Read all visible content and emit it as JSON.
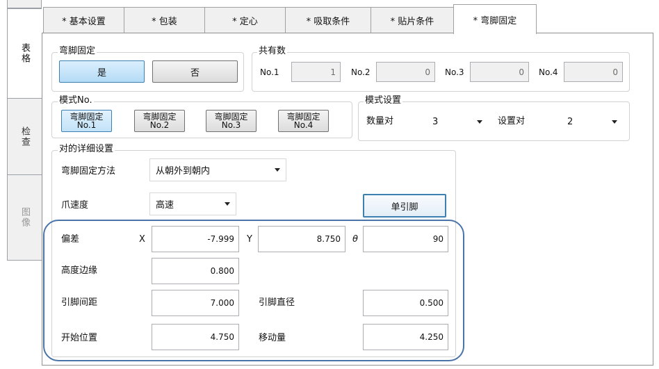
{
  "side_tabs": [
    "表格",
    "检查",
    "图像"
  ],
  "tabs": [
    "* 基本设置",
    "* 包装",
    "* 定心",
    "* 吸取条件",
    "* 贴片条件",
    "* 弯脚固定"
  ],
  "lead_clinch": {
    "group_label": "弯脚固定",
    "yes_label": "是",
    "no_label": "否"
  },
  "shared": {
    "group_label": "共有数",
    "items": [
      {
        "label": "No.1",
        "value": "1"
      },
      {
        "label": "No.2",
        "value": "0"
      },
      {
        "label": "No.3",
        "value": "0"
      },
      {
        "label": "No.4",
        "value": "0"
      }
    ]
  },
  "pattern_no": {
    "group_label": "模式No.",
    "buttons": [
      {
        "line1": "弯脚固定",
        "line2": "No.1"
      },
      {
        "line1": "弯脚固定",
        "line2": "No.2"
      },
      {
        "line1": "弯脚固定",
        "line2": "No.3"
      },
      {
        "line1": "弯脚固定",
        "line2": "No.4"
      }
    ]
  },
  "pattern_settings": {
    "group_label": "模式设置",
    "count_label": "数量对",
    "count_value": "3",
    "set_label": "设置对",
    "set_value": "2"
  },
  "detail": {
    "group_label": "对的详细设置",
    "method_label": "弯脚固定方法",
    "method_value": "从朝外到朝内",
    "speed_label": "爪速度",
    "speed_value": "高速",
    "single_lead_label": "单引脚",
    "offset_label": "偏差",
    "x_label": "X",
    "x_value": "-7.999",
    "y_label": "Y",
    "y_value": "8.750",
    "theta_label": "θ",
    "theta_value": "90",
    "height_label": "高度边缘",
    "height_value": "0.800",
    "pitch_label": "引脚间距",
    "pitch_value": "7.000",
    "diameter_label": "引脚直径",
    "diameter_value": "0.500",
    "start_label": "开始位置",
    "start_value": "4.750",
    "move_label": "移动量",
    "move_value": "4.250"
  },
  "colors": {
    "selected_button": "#c2e2f8",
    "highlight_outline": "#4a73a8"
  }
}
